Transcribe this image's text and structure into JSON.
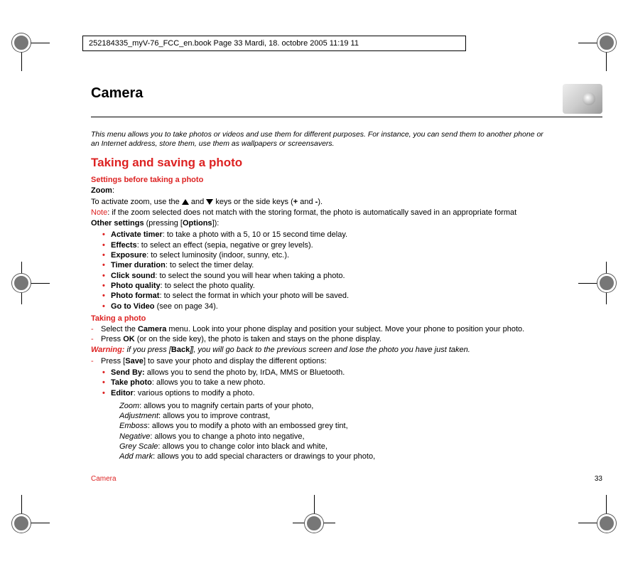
{
  "header_bar": "252184335_myV-76_FCC_en.book  Page 33  Mardi, 18. octobre 2005  11:19 11",
  "title": "Camera",
  "intro": "This menu allows you to take photos or videos and use them for different purposes. For instance, you can send them to another phone or an Internet address, store them, use them as wallpapers or screensavers.",
  "section_heading": "Taking and saving a photo",
  "settings_heading": "Settings before taking a photo",
  "zoom_label": "Zoom",
  "zoom_text_a": "To activate zoom, use the ",
  "zoom_text_b": " and ",
  "zoom_text_c": " keys or the side keys (",
  "zoom_plus": "+",
  "zoom_text_d": " and ",
  "zoom_minus": "-",
  "zoom_text_e": ").",
  "note_label": "Note",
  "note_text": ": if the zoom selected does not match with the storing format, the photo is automatically saved in an appropriate format",
  "other_label": "Other settings",
  "other_text_a": " (pressing [",
  "options_label": "Options",
  "other_text_b": "]):",
  "opts": [
    {
      "b": "Activate timer",
      "t": ": to take a photo with a 5, 10 or 15 second time delay."
    },
    {
      "b": "Effects",
      "t": ": to select an effect (sepia, negative or grey levels)."
    },
    {
      "b": "Exposure",
      "t": ": to select luminosity (indoor, sunny, etc.)."
    },
    {
      "b": "Timer duration",
      "t": ": to select the timer delay."
    },
    {
      "b": "Click sound",
      "t": ": to select the sound you will hear when taking a photo."
    },
    {
      "b": "Photo quality",
      "t": ": to select the photo quality."
    },
    {
      "b": "Photo format",
      "t": ": to select the format in which your photo will be saved."
    },
    {
      "b": "Go to Video",
      "t": " (see on page 34)."
    }
  ],
  "taking_heading": "Taking a photo",
  "step1_a": "Select the ",
  "step1_b": "Camera",
  "step1_c": " menu. Look into your phone display and position your subject. Move your phone to position your photo.",
  "step2_a": "Press ",
  "step2_b": "OK",
  "step2_c": " (or on the side key), the photo is taken and stays on the phone display.",
  "warning_label": "Warning:",
  "warning_a": " if you press [",
  "warning_b": "Back",
  "warning_c": "], you will go back to the previous screen and lose the photo you have just taken.",
  "save_a": "Press [",
  "save_b": "Save",
  "save_c": "] to save your photo and display the different options:",
  "save_opts": [
    {
      "b": "Send By:",
      "t": " allows you to send the photo by,  IrDA, MMS or  Bluetooth."
    },
    {
      "b": "Take photo",
      "t": ": allows you to take a new photo."
    },
    {
      "b": "Editor",
      "t": ": various options to modify a photo."
    }
  ],
  "editor": [
    {
      "i": "Zoom",
      "t": ": allows you to magnify certain parts of your photo,"
    },
    {
      "i": "Adjustment",
      "t": ": allows you to improve contrast,"
    },
    {
      "i": "Emboss",
      "t": ": allows you to modify a photo with an embossed grey tint,"
    },
    {
      "i": "Negative",
      "t": ": allows you to change a photo into negative,"
    },
    {
      "i": "Grey Scale",
      "t": ": allows you to change color into black and white,"
    },
    {
      "i": "Add mark",
      "t": ": allows you to add special characters or drawings to your photo,"
    }
  ],
  "footer_left": "Camera",
  "footer_right": "33"
}
